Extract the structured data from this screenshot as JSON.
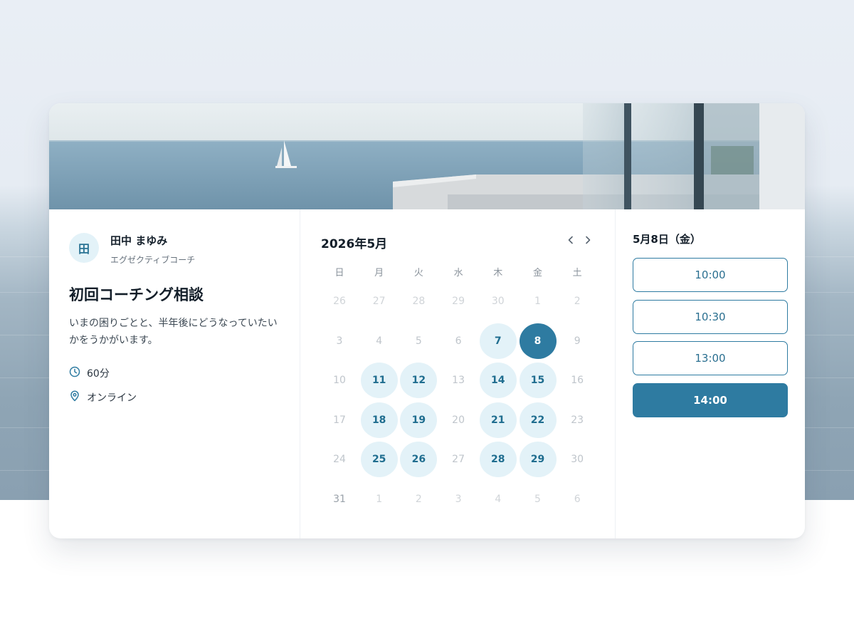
{
  "host": {
    "initial": "田",
    "name": "田中 まゆみ",
    "title": "エグゼクティブコーチ"
  },
  "event": {
    "title": "初回コーチング相談",
    "description": "いまの困りごとと、半年後にどうなっていたいかをうかがいます。",
    "duration": "60分",
    "location": "オンライン"
  },
  "calendar": {
    "month_label": "2026年5月",
    "weekdays": [
      "日",
      "月",
      "火",
      "水",
      "木",
      "金",
      "土"
    ],
    "weeks": [
      [
        {
          "d": "26",
          "s": "muted"
        },
        {
          "d": "27",
          "s": "muted"
        },
        {
          "d": "28",
          "s": "muted"
        },
        {
          "d": "29",
          "s": "muted"
        },
        {
          "d": "30",
          "s": "muted"
        },
        {
          "d": "1",
          "s": "muted"
        },
        {
          "d": "2",
          "s": "muted"
        }
      ],
      [
        {
          "d": "3",
          "s": "off"
        },
        {
          "d": "4",
          "s": "off"
        },
        {
          "d": "5",
          "s": "off"
        },
        {
          "d": "6",
          "s": "off"
        },
        {
          "d": "7",
          "s": "avail"
        },
        {
          "d": "8",
          "s": "selected"
        },
        {
          "d": "9",
          "s": "off"
        }
      ],
      [
        {
          "d": "10",
          "s": "off"
        },
        {
          "d": "11",
          "s": "avail"
        },
        {
          "d": "12",
          "s": "avail"
        },
        {
          "d": "13",
          "s": "off"
        },
        {
          "d": "14",
          "s": "avail"
        },
        {
          "d": "15",
          "s": "avail"
        },
        {
          "d": "16",
          "s": "off"
        }
      ],
      [
        {
          "d": "17",
          "s": "off"
        },
        {
          "d": "18",
          "s": "avail"
        },
        {
          "d": "19",
          "s": "avail"
        },
        {
          "d": "20",
          "s": "off"
        },
        {
          "d": "21",
          "s": "avail"
        },
        {
          "d": "22",
          "s": "avail"
        },
        {
          "d": "23",
          "s": "off"
        }
      ],
      [
        {
          "d": "24",
          "s": "off"
        },
        {
          "d": "25",
          "s": "avail"
        },
        {
          "d": "26",
          "s": "avail"
        },
        {
          "d": "27",
          "s": "off"
        },
        {
          "d": "28",
          "s": "avail"
        },
        {
          "d": "29",
          "s": "avail"
        },
        {
          "d": "30",
          "s": "off"
        }
      ],
      [
        {
          "d": "31",
          "s": "today"
        },
        {
          "d": "1",
          "s": "muted"
        },
        {
          "d": "2",
          "s": "muted"
        },
        {
          "d": "3",
          "s": "muted"
        },
        {
          "d": "4",
          "s": "muted"
        },
        {
          "d": "5",
          "s": "muted"
        },
        {
          "d": "6",
          "s": "muted"
        }
      ]
    ]
  },
  "times": {
    "date_label": "5月8日（金）",
    "slots": [
      {
        "label": "10:00",
        "selected": false
      },
      {
        "label": "10:30",
        "selected": false
      },
      {
        "label": "13:00",
        "selected": false
      },
      {
        "label": "14:00",
        "selected": true
      }
    ]
  },
  "icons": {
    "duration": "clock-icon",
    "location": "map-pin-icon",
    "prev": "chevron-left-icon",
    "next": "chevron-right-icon"
  },
  "colors": {
    "accent": "#2e7ba1",
    "available_bg": "#e3f2f8",
    "available_text": "#1f6d8f"
  }
}
